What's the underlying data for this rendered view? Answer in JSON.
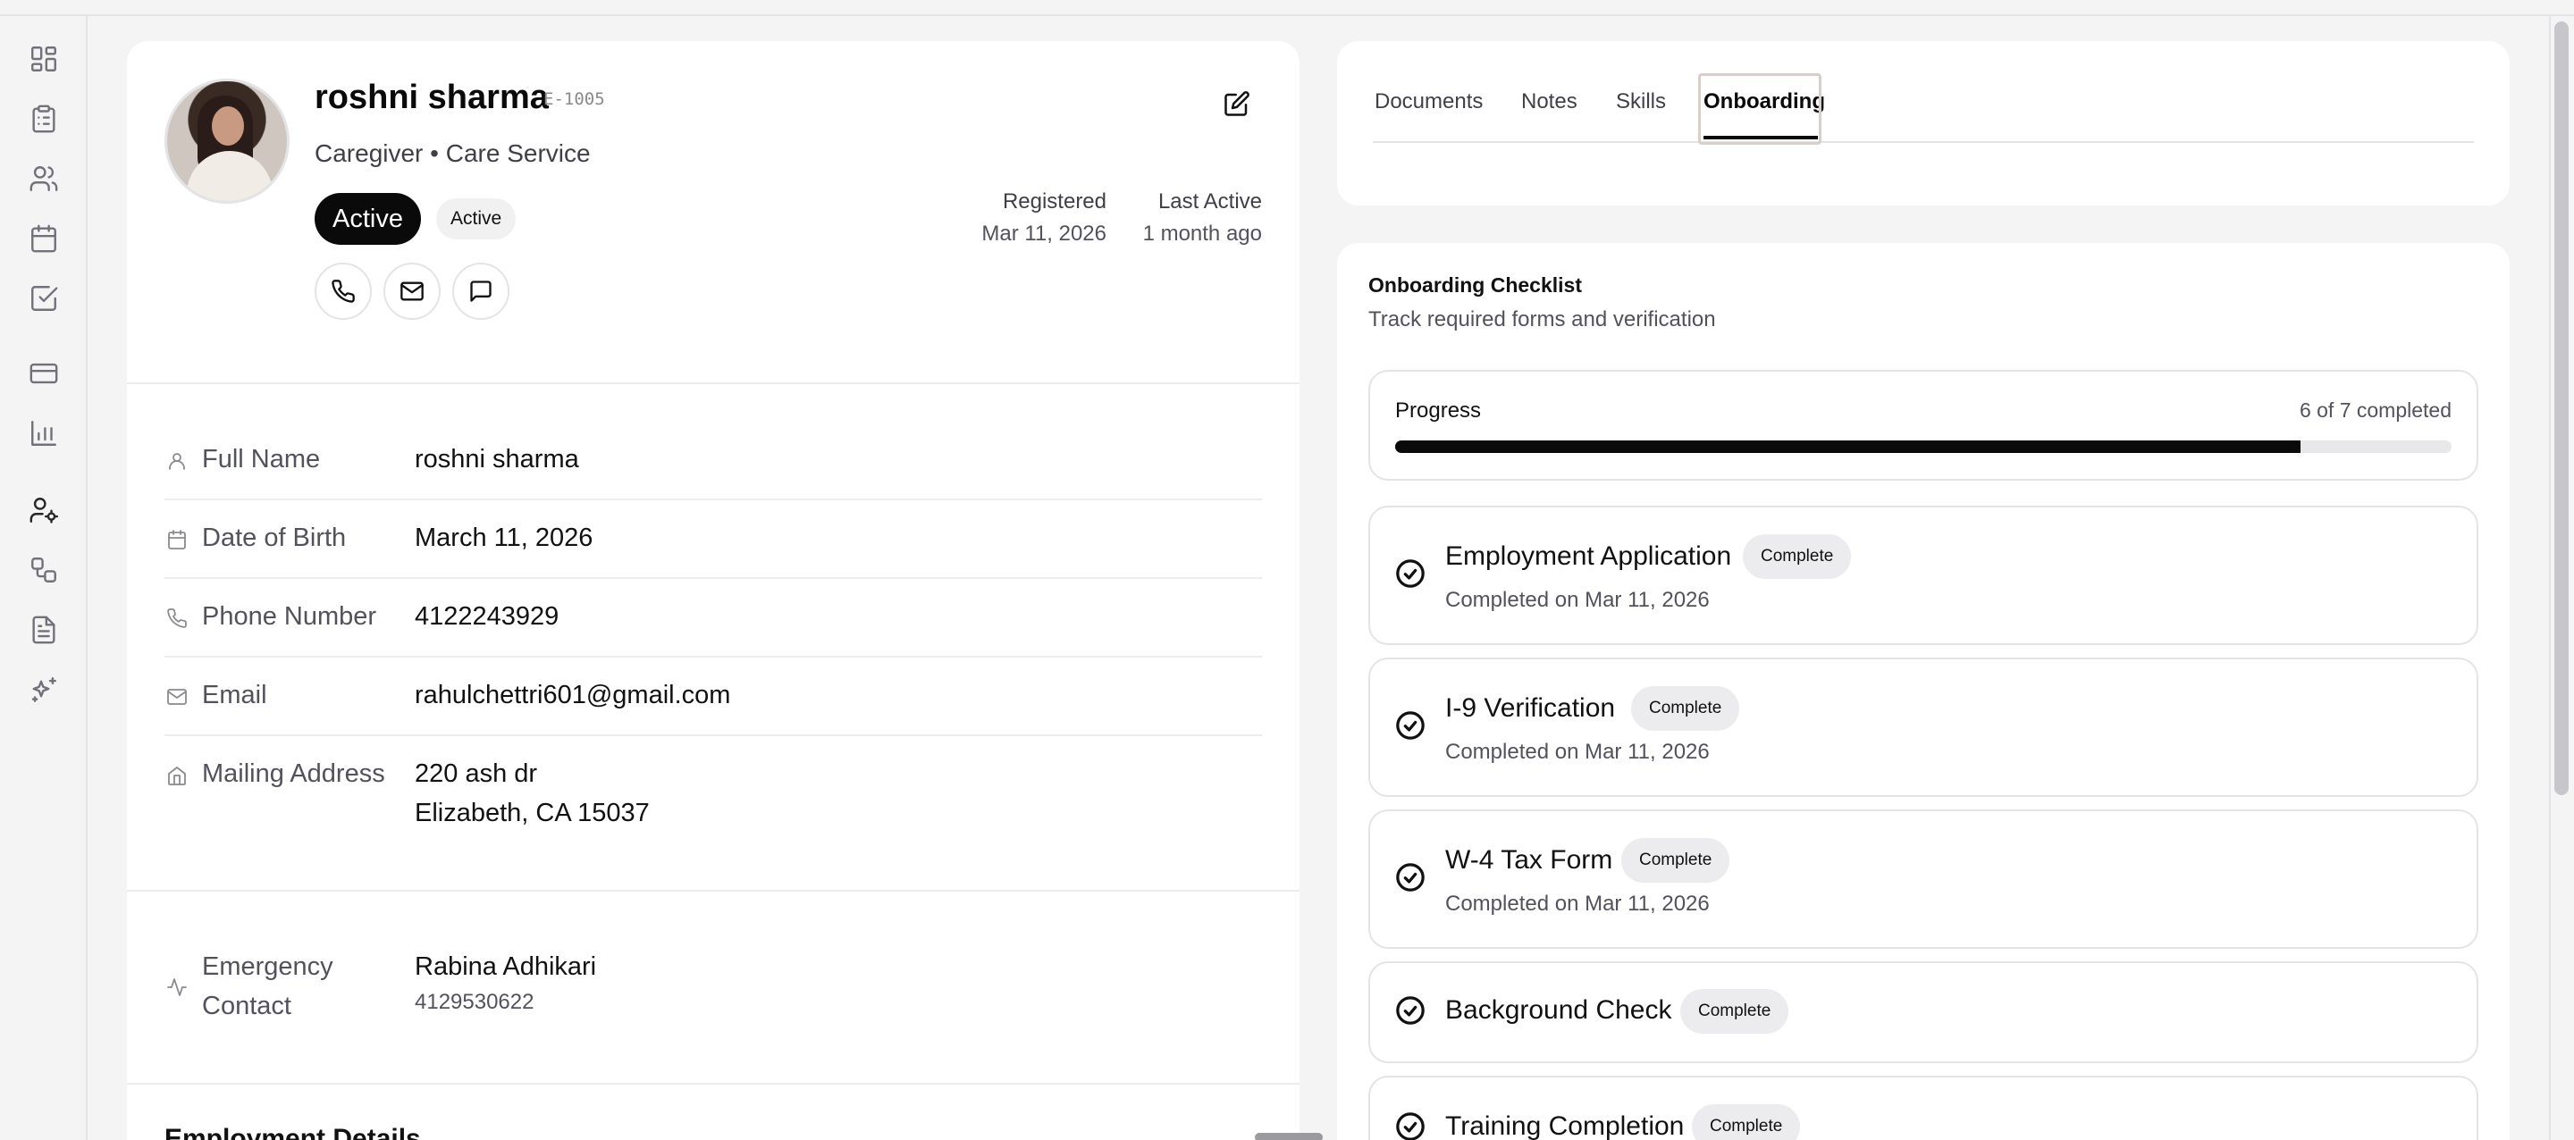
{
  "sidebar": {
    "icons": [
      "dashboard-icon",
      "clipboard-icon",
      "users-icon",
      "calendar-icon",
      "checkbox-icon",
      "credit-card-icon",
      "bar-chart-icon",
      "user-settings-icon",
      "workflow-icon",
      "document-icon",
      "sparkles-icon"
    ]
  },
  "profile": {
    "name": "roshni sharma",
    "employee_id": "E-1005",
    "role": "Caregiver • Care Service",
    "status_primary": "Active",
    "status_secondary": "Active",
    "registered_label": "Registered",
    "registered_value": "Mar 11, 2026",
    "last_active_label": "Last Active",
    "last_active_value": "1 month ago"
  },
  "details": {
    "full_name_label": "Full Name",
    "full_name_value": "roshni sharma",
    "dob_label": "Date of Birth",
    "dob_value": "March 11, 2026",
    "phone_label": "Phone Number",
    "phone_value": "4122243929",
    "email_label": "Email",
    "email_value": "rahulchettri601@gmail.com",
    "address_label": "Mailing Address",
    "address_line1": "220 ash dr",
    "address_line2": "Elizabeth, CA 15037",
    "emergency_label_1": "Emergency",
    "emergency_label_2": "Contact",
    "emergency_name": "Rabina Adhikari",
    "emergency_phone": "4129530622",
    "employment_title": "Employment Details"
  },
  "tabs": {
    "documents": "Documents",
    "notes": "Notes",
    "skills": "Skills",
    "onboarding": "Onboarding",
    "active": "Onboarding"
  },
  "checklist": {
    "title": "Onboarding Checklist",
    "subtitle": "Track required forms and verification",
    "progress_label": "Progress",
    "progress_count": "6 of 7 completed",
    "progress_fraction": 0.857,
    "items": [
      {
        "title": "Employment Application",
        "badge": "Complete",
        "sub": "Completed on Mar 11, 2026"
      },
      {
        "title": "I-9 Verification",
        "badge": "Complete",
        "sub": "Completed on Mar 11, 2026"
      },
      {
        "title": "W-4 Tax Form",
        "badge": "Complete",
        "sub": "Completed on Mar 11, 2026"
      },
      {
        "title": "Background Check",
        "badge": "Complete",
        "sub": ""
      },
      {
        "title": "Training Completion",
        "badge": "Complete",
        "sub": ""
      }
    ]
  }
}
